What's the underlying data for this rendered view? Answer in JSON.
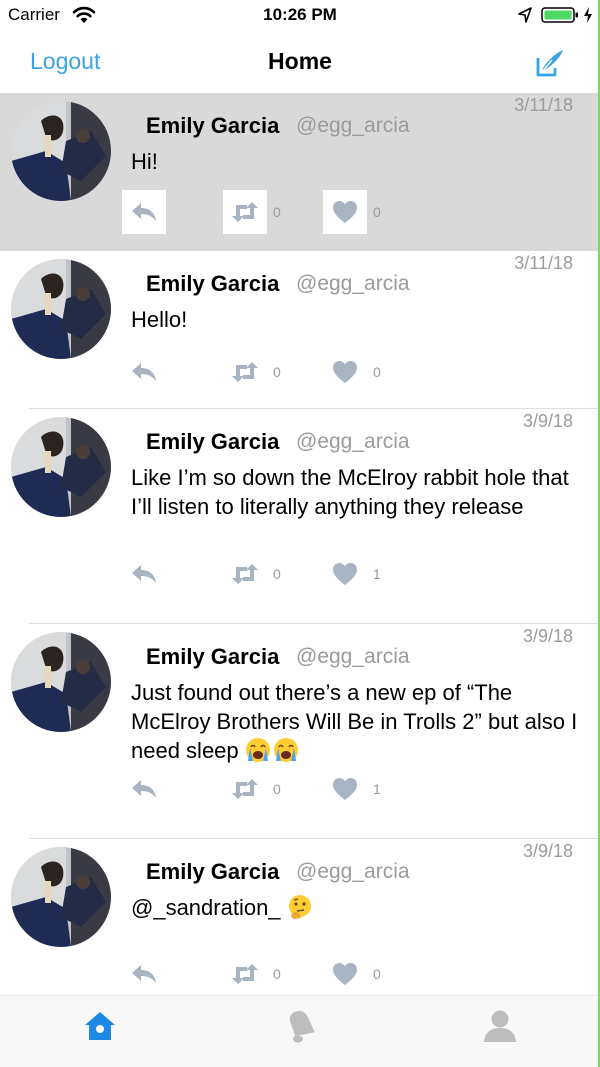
{
  "status_bar": {
    "carrier": "Carrier",
    "time": "10:26 PM"
  },
  "nav": {
    "logout_label": "Logout",
    "title": "Home",
    "compose_icon": "compose-tweet-icon"
  },
  "colors": {
    "accent": "#3aa3e3",
    "secondary_text": "#9b9b9b",
    "highlight_row": "#d9d9d9",
    "action_icon": "#a9b4c2"
  },
  "tweets": [
    {
      "name": "Emily Garcia",
      "handle": "@egg_arcia",
      "date": "3/11/18",
      "text": "Hi!",
      "retweets": "0",
      "likes": "0",
      "highlighted": true
    },
    {
      "name": "Emily Garcia",
      "handle": "@egg_arcia",
      "date": "3/11/18",
      "text": "Hello!",
      "retweets": "0",
      "likes": "0"
    },
    {
      "name": "Emily Garcia",
      "handle": "@egg_arcia",
      "date": "3/9/18",
      "text": "Like I’m so down the McElroy rabbit hole that I’ll listen to literally anything they release",
      "retweets": "0",
      "likes": "1"
    },
    {
      "name": "Emily Garcia",
      "handle": "@egg_arcia",
      "date": "3/9/18",
      "text": "Just found out there’s a new ep of “The McElroy Brothers Will Be in Trolls 2” but also I need sleep ",
      "emojis": [
        "crying-face",
        "crying-face"
      ],
      "retweets": "0",
      "likes": "1"
    },
    {
      "name": "Emily Garcia",
      "handle": "@egg_arcia",
      "date": "3/9/18",
      "text": "@_sandration_ ",
      "emojis": [
        "thinking-face"
      ],
      "retweets": "0",
      "likes": "0"
    }
  ],
  "tab_bar": {
    "tabs": [
      {
        "icon": "home-icon",
        "active": true
      },
      {
        "icon": "bell-icon",
        "active": false
      },
      {
        "icon": "profile-icon",
        "active": false
      }
    ]
  }
}
